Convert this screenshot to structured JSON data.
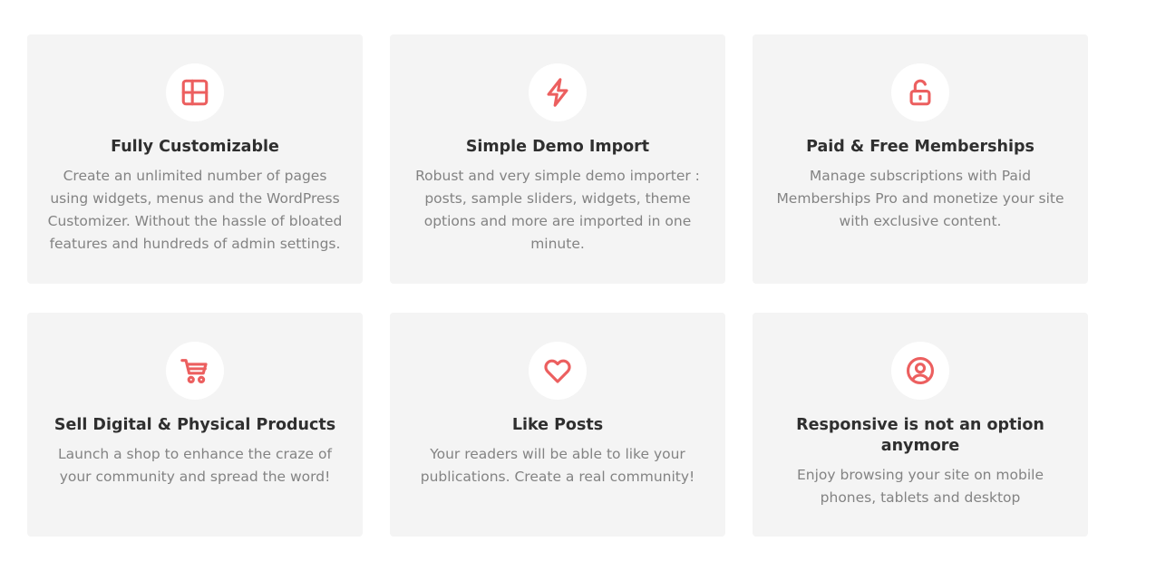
{
  "colors": {
    "accent": "#ec5f5f",
    "card_background": "#f4f4f4",
    "title": "#2f2f2f",
    "text": "#838383"
  },
  "features": [
    {
      "icon": "layout-icon",
      "title": "Fully Customizable",
      "description": "Create an unlimited number of pages using widgets, menus and the WordPress Customizer. Without the hassle of bloated features and hundreds of admin settings."
    },
    {
      "icon": "lightning-icon",
      "title": "Simple Demo Import",
      "description": "Robust and very simple demo importer : posts, sample sliders, widgets, theme options and more are imported in one minute."
    },
    {
      "icon": "unlock-icon",
      "title": "Paid & Free Memberships",
      "description": "Manage subscriptions with Paid Memberships Pro and monetize your site with exclusive content."
    },
    {
      "icon": "shopping-cart-icon",
      "title": "Sell Digital & Physical Products",
      "description": "Launch a shop to enhance the craze of your community and spread the word!"
    },
    {
      "icon": "heart-icon",
      "title": "Like Posts",
      "description": "Your readers will be able to like your publications. Create a real community!"
    },
    {
      "icon": "user-circle-icon",
      "title": "Responsive is not an option anymore",
      "description": "Enjoy browsing your site on mobile phones, tablets and desktop"
    }
  ]
}
